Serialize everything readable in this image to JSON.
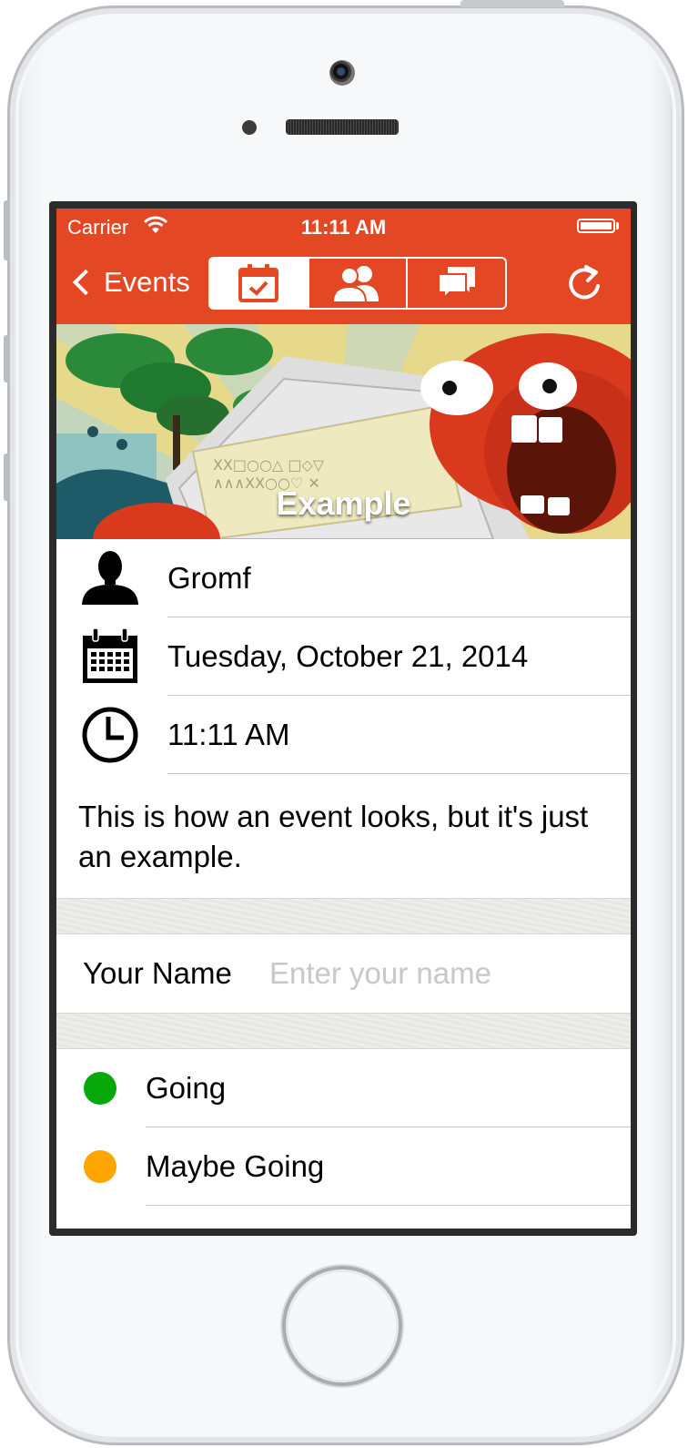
{
  "status_bar": {
    "carrier": "Carrier",
    "time": "11:11 AM"
  },
  "nav": {
    "back_label": "Events",
    "segments": [
      {
        "icon": "calendar-check-icon",
        "active": true
      },
      {
        "icon": "people-icon",
        "active": false
      },
      {
        "icon": "chat-bubbles-icon",
        "active": false
      }
    ],
    "refresh_icon": "refresh-icon",
    "accent_color": "#e34723"
  },
  "banner": {
    "title": "Example"
  },
  "event": {
    "organizer": "Gromf",
    "date": "Tuesday, October 21, 2014",
    "time": "11:11 AM",
    "description": "This is how an event looks, but it's just an example."
  },
  "form": {
    "name_label": "Your Name",
    "name_placeholder": "Enter your name",
    "name_value": ""
  },
  "rsvp": [
    {
      "label": "Going",
      "color": "#06a80a"
    },
    {
      "label": "Maybe Going",
      "color": "#ffa500"
    }
  ]
}
